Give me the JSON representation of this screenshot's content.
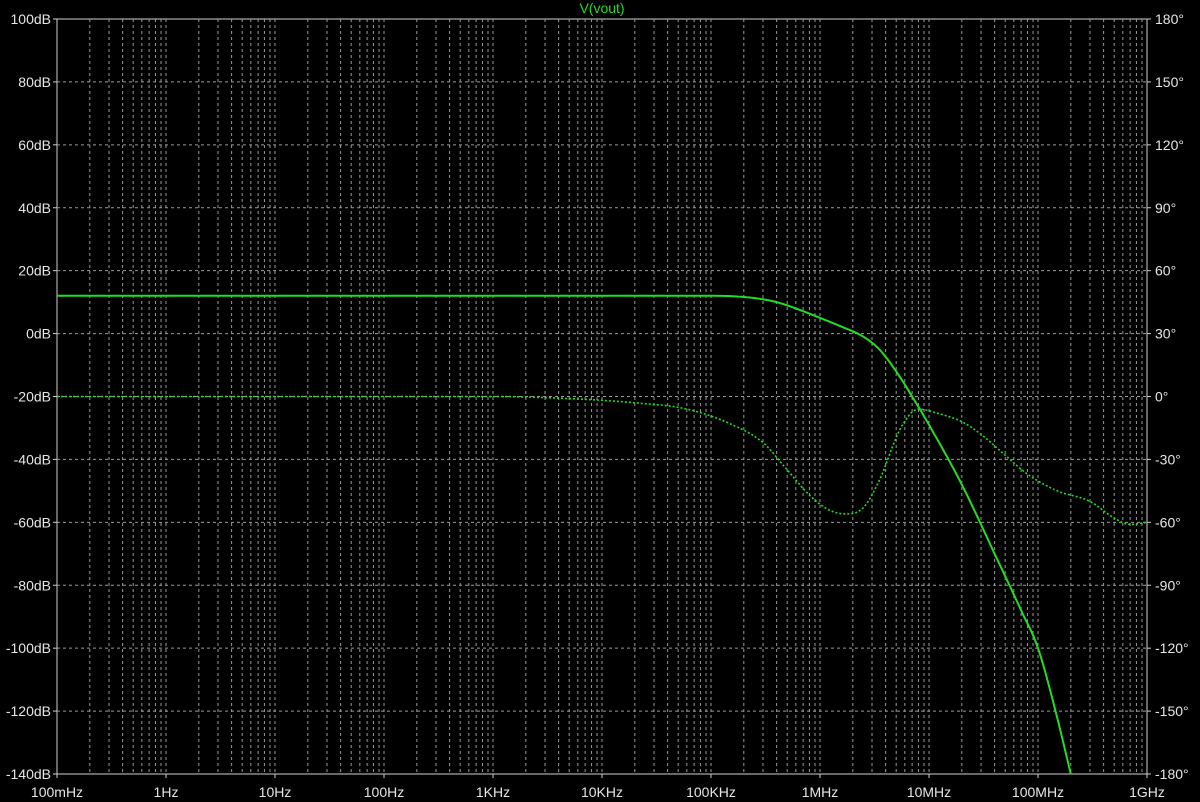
{
  "chart_data": {
    "type": "line",
    "title": "V(vout)",
    "x_scale": "log",
    "xlim": [
      0.1,
      1000000000
    ],
    "x_ticks": [
      {
        "value": 0.1,
        "label": "100mHz"
      },
      {
        "value": 1,
        "label": "1Hz"
      },
      {
        "value": 10,
        "label": "10Hz"
      },
      {
        "value": 100,
        "label": "100Hz"
      },
      {
        "value": 1000,
        "label": "1KHz"
      },
      {
        "value": 10000,
        "label": "10KHz"
      },
      {
        "value": 100000,
        "label": "100KHz"
      },
      {
        "value": 1000000,
        "label": "1MHz"
      },
      {
        "value": 10000000,
        "label": "10MHz"
      },
      {
        "value": 100000000,
        "label": "100MHz"
      },
      {
        "value": 1000000000,
        "label": "1GHz"
      }
    ],
    "y_left": {
      "unit": "dB",
      "lim": [
        -140,
        100
      ],
      "ticks": [
        {
          "value": 100,
          "label": "100dB"
        },
        {
          "value": 80,
          "label": "80dB"
        },
        {
          "value": 60,
          "label": "60dB"
        },
        {
          "value": 40,
          "label": "40dB"
        },
        {
          "value": 20,
          "label": "20dB"
        },
        {
          "value": 0,
          "label": "0dB"
        },
        {
          "value": -20,
          "label": "-20dB"
        },
        {
          "value": -40,
          "label": "-40dB"
        },
        {
          "value": -60,
          "label": "-60dB"
        },
        {
          "value": -80,
          "label": "-80dB"
        },
        {
          "value": -100,
          "label": "-100dB"
        },
        {
          "value": -120,
          "label": "-120dB"
        },
        {
          "value": -140,
          "label": "-140dB"
        }
      ]
    },
    "y_right": {
      "unit": "°",
      "lim": [
        -180,
        180
      ],
      "ticks": [
        {
          "value": 180,
          "label": "180°"
        },
        {
          "value": 150,
          "label": "150°"
        },
        {
          "value": 120,
          "label": "120°"
        },
        {
          "value": 90,
          "label": "90°"
        },
        {
          "value": 60,
          "label": "60°"
        },
        {
          "value": 30,
          "label": "30°"
        },
        {
          "value": 0,
          "label": "0°"
        },
        {
          "value": -30,
          "label": "-30°"
        },
        {
          "value": -60,
          "label": "-60°"
        },
        {
          "value": -90,
          "label": "-90°"
        },
        {
          "value": -120,
          "label": "-120°"
        },
        {
          "value": -150,
          "label": "-150°"
        },
        {
          "value": -180,
          "label": "-180°"
        }
      ]
    },
    "grid": true,
    "series": [
      {
        "axis": "left",
        "color": "#22dd22",
        "style": "solid",
        "points": [
          [
            0.1,
            12
          ],
          [
            1000,
            12
          ],
          [
            100000,
            12
          ],
          [
            150000,
            11.9
          ],
          [
            250000,
            11.3
          ],
          [
            400000,
            10
          ],
          [
            600000,
            8
          ],
          [
            1000000,
            5
          ],
          [
            1500000,
            2.5
          ],
          [
            2500000,
            -1
          ],
          [
            3500000,
            -5
          ],
          [
            5000000,
            -12
          ],
          [
            7000000,
            -20
          ],
          [
            10000000,
            -29
          ],
          [
            20000000,
            -48
          ],
          [
            40000000,
            -70
          ],
          [
            70000000,
            -88
          ],
          [
            100000000,
            -100
          ],
          [
            140000000,
            -118
          ],
          [
            200000000,
            -140
          ]
        ]
      },
      {
        "axis": "right",
        "color": "#22dd22",
        "style": "dotted",
        "points": [
          [
            0.1,
            0
          ],
          [
            1000,
            0
          ],
          [
            5000,
            -1
          ],
          [
            20000,
            -3
          ],
          [
            60000,
            -6
          ],
          [
            150000,
            -13
          ],
          [
            300000,
            -22
          ],
          [
            500000,
            -35
          ],
          [
            800000,
            -47
          ],
          [
            1200000,
            -54
          ],
          [
            1700000,
            -56
          ],
          [
            2500000,
            -53
          ],
          [
            3500000,
            -40
          ],
          [
            5500000,
            -15
          ],
          [
            8000000,
            -6
          ],
          [
            12000000,
            -8
          ],
          [
            20000000,
            -12
          ],
          [
            30000000,
            -18
          ],
          [
            50000000,
            -28
          ],
          [
            80000000,
            -37
          ],
          [
            150000000,
            -45
          ],
          [
            300000000,
            -50
          ],
          [
            500000000,
            -58
          ],
          [
            700000000,
            -61
          ],
          [
            1000000000,
            -60
          ]
        ]
      }
    ]
  }
}
